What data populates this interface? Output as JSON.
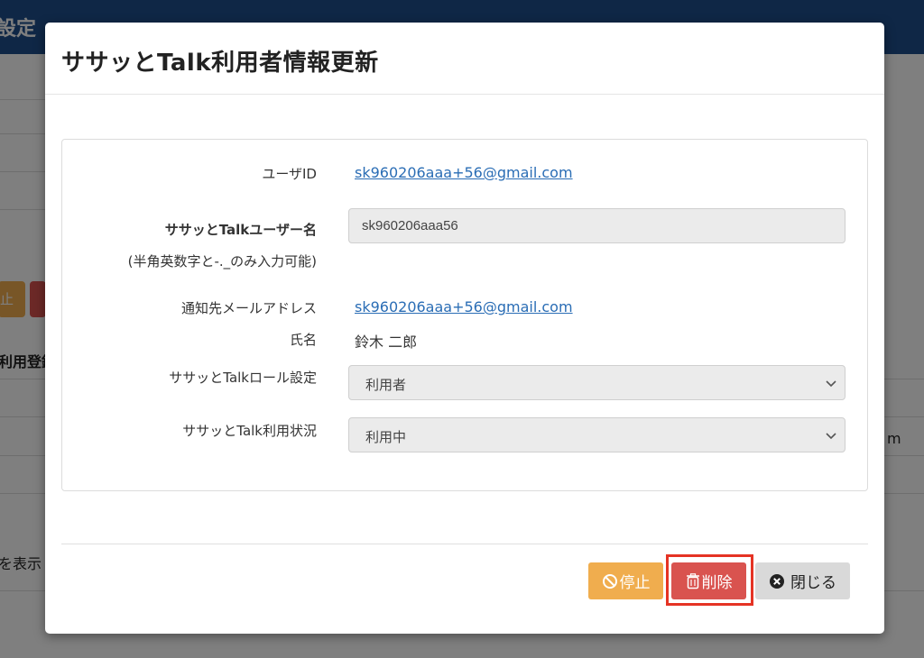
{
  "background": {
    "header_title": "設定",
    "row_text_1": "利用登録",
    "row_text_2": "を表示",
    "row_text_3": "m",
    "stop_btn_fragment": "止"
  },
  "modal": {
    "title": "ササッとTalk利用者情報更新",
    "fields": {
      "user_id_label": "ユーザID",
      "user_id_value": "sk960206aaa+56@gmail.com",
      "username_label": "ササッとTalkユーザー名",
      "username_note": "(半角英数字と-._のみ入力可能)",
      "username_value": "sk960206aaa56",
      "email_label": "通知先メールアドレス",
      "email_value": "sk960206aaa+56@gmail.com",
      "name_label": "氏名",
      "name_value": "鈴木 二郎",
      "role_label": "ササッとTalkロール設定",
      "role_value": "利用者",
      "status_label": "ササッとTalk利用状況",
      "status_value": "利用中"
    },
    "buttons": {
      "stop_label": "停止",
      "delete_label": "削除",
      "close_label": "閉じる"
    }
  },
  "colors": {
    "header": "#1f4e8c",
    "stop": "#f0ad4e",
    "delete": "#d9534f",
    "link": "#2a6db5",
    "highlight": "#e53324"
  }
}
